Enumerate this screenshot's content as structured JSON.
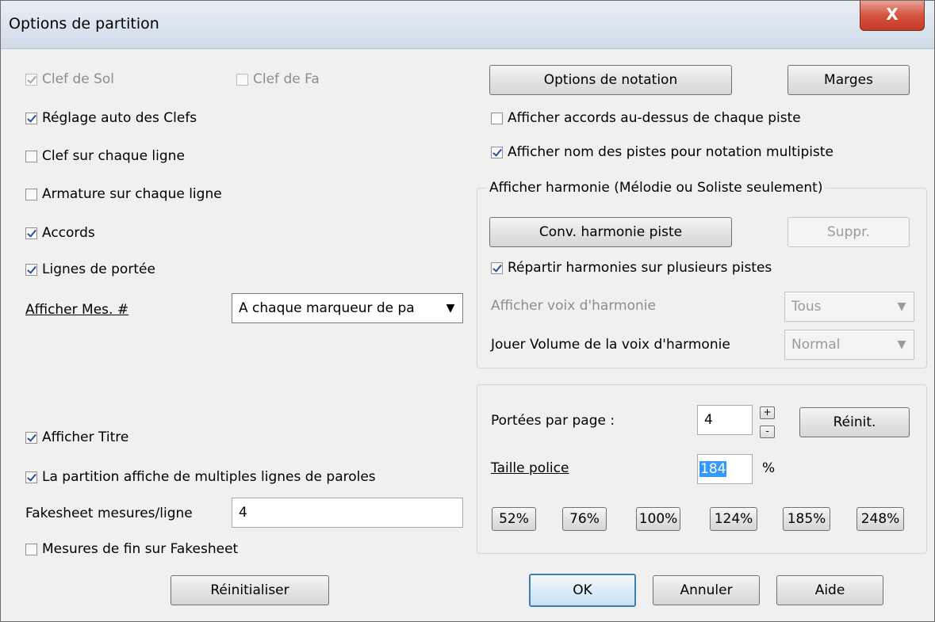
{
  "window": {
    "title": "Options de partition",
    "close_label": "X"
  },
  "left": {
    "clef_sol": "Clef de Sol",
    "clef_fa": "Clef de Fa",
    "auto_clefs": "Réglage auto des Clefs",
    "clef_each_line": "Clef sur chaque ligne",
    "key_each_line": "Armature sur chaque ligne",
    "chords": "Accords",
    "staff_lines": "Lignes de portée",
    "show_bar_label": "Afficher Mes. #",
    "show_bar_value": "A chaque marqueur de pa",
    "show_title": "Afficher Titre",
    "multi_lyrics": "La partition affiche de multiples lignes de paroles",
    "fakesheet_label": "Fakesheet mesures/ligne",
    "fakesheet_value": "4",
    "end_bars": "Mesures de fin sur Fakesheet",
    "reset_label": "Réinitialiser"
  },
  "right": {
    "notation_options": "Options de notation",
    "margins": "Marges",
    "chords_above": "Afficher accords au-dessus de chaque piste",
    "track_names": "Afficher nom des pistes pour notation multipiste",
    "harmony_group": "Afficher harmonie (Mélodie ou Soliste seulement)",
    "conv_harmony": "Conv. harmonie piste",
    "delete": "Suppr.",
    "split_harmony": "Répartir harmonies sur plusieurs pistes",
    "show_voice_label": "Afficher voix d'harmonie",
    "show_voice_value": "Tous",
    "volume_label": "Jouer Volume de la voix d'harmonie",
    "volume_value": "Normal",
    "staves_label": "Portées par page :",
    "staves_value": "4",
    "spin_up": "+",
    "spin_down": "-",
    "reinit": "Réinit.",
    "font_size_label": "Taille police",
    "font_size_value": "184",
    "percent": "%",
    "presets": [
      "52%",
      "76%",
      "100%",
      "124%",
      "185%",
      "248%"
    ]
  },
  "footer": {
    "ok": "OK",
    "cancel": "Annuler",
    "help": "Aide"
  },
  "state": {
    "clef_sol": true,
    "clef_fa": false,
    "auto_clefs": true,
    "clef_each_line": false,
    "key_each_line": false,
    "chords": true,
    "staff_lines": true,
    "show_title": true,
    "multi_lyrics": true,
    "end_bars": false,
    "chords_above": false,
    "track_names": true,
    "split_harmony": true
  }
}
